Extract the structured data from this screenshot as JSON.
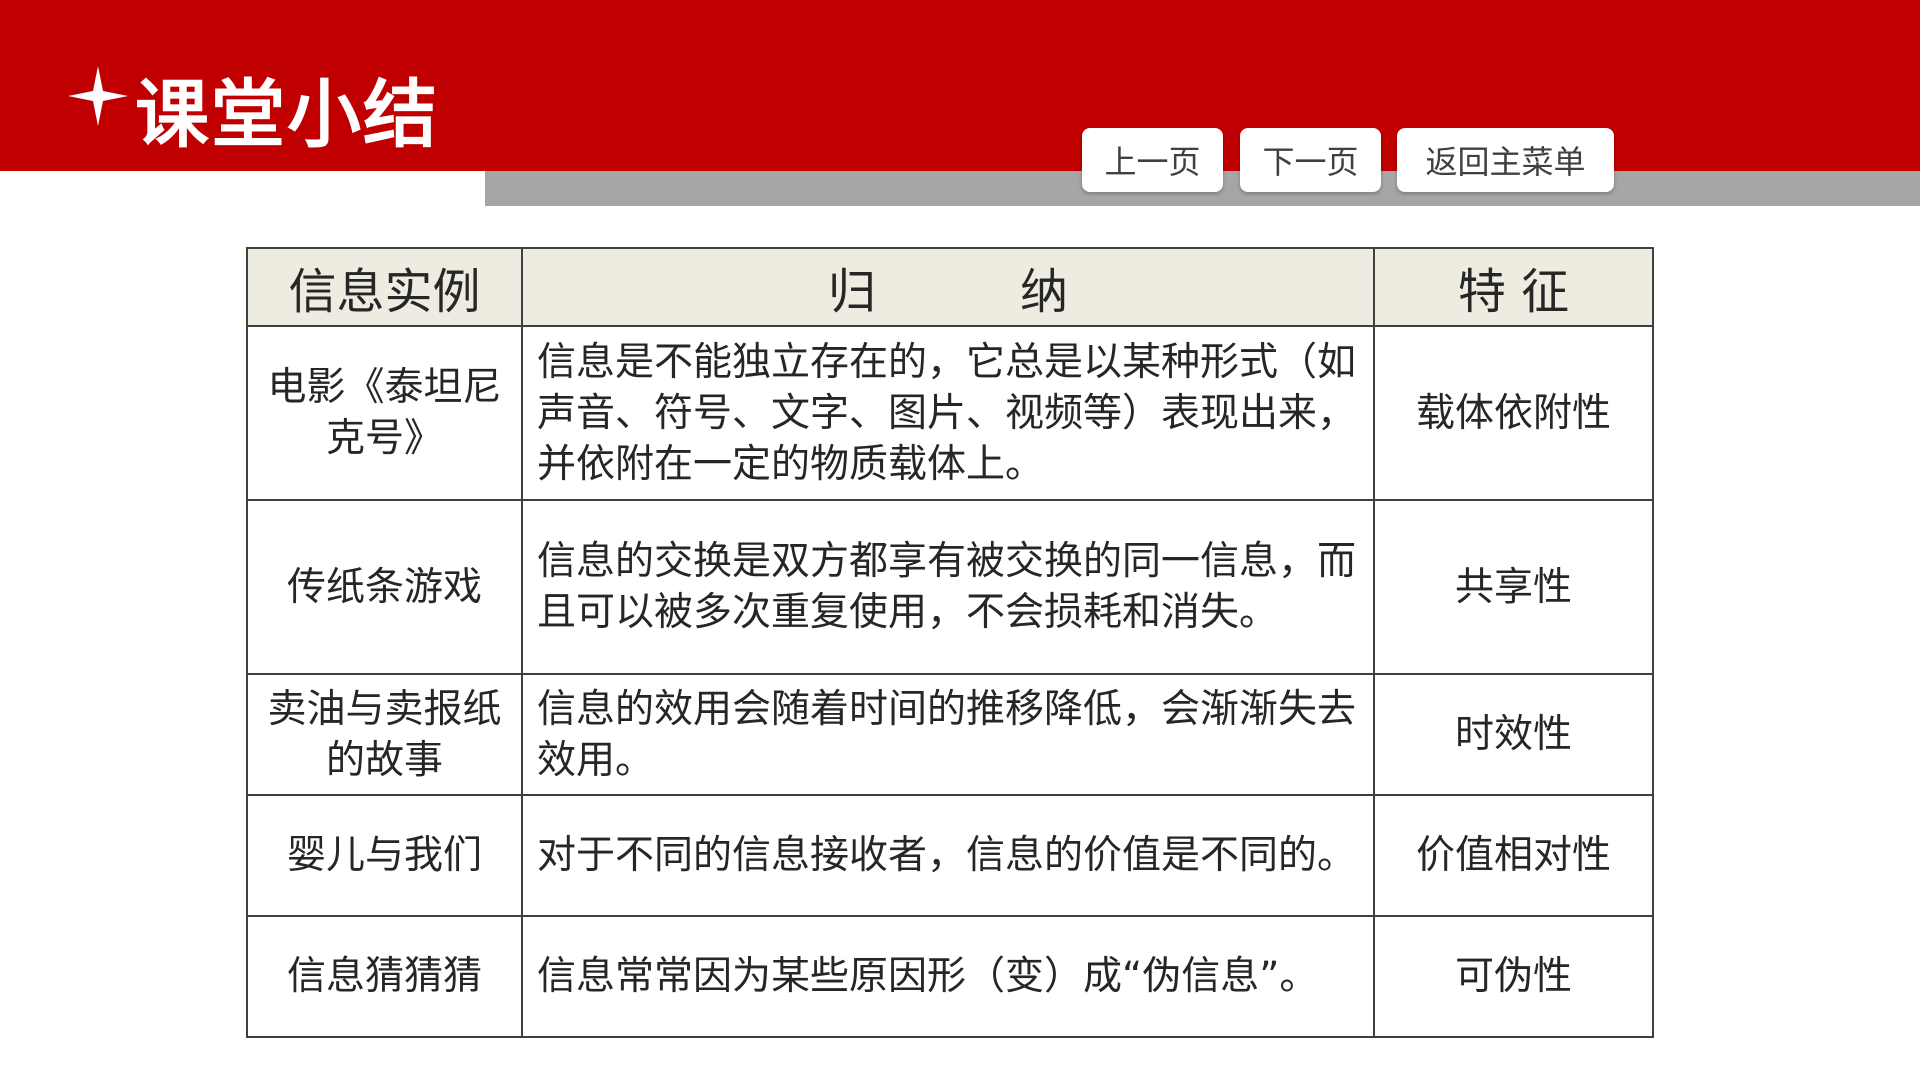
{
  "header": {
    "title": "课堂小结",
    "accent_color": "#c00000",
    "strip_color": "#a6a6a6",
    "icon": "star-icon"
  },
  "nav": {
    "prev_label": "上一页",
    "next_label": "下一页",
    "home_label": "返回主菜单"
  },
  "table": {
    "header_bg": "#eeece1",
    "columns": [
      "信息实例",
      "归　　　纳",
      "特 征"
    ],
    "rows": [
      {
        "example": "电影《泰坦尼克号》",
        "summary": "信息是不能独立存在的，它总是以某种形式（如声音、符号、文字、图片、视频等）表现出来，并依附在一定的物质载体上。",
        "feature": "载体依附性"
      },
      {
        "example": "传纸条游戏",
        "summary": "信息的交换是双方都享有被交换的同一信息，而且可以被多次重复使用，不会损耗和消失。",
        "feature": "共享性"
      },
      {
        "example": "卖油与卖报纸的故事",
        "summary": "信息的效用会随着时间的推移降低，会渐渐失去效用。",
        "feature": "时效性"
      },
      {
        "example": "婴儿与我们",
        "summary": "对于不同的信息接收者，信息的价值是不同的。",
        "feature": "价值相对性"
      },
      {
        "example": "信息猜猜猜",
        "summary": "信息常常因为某些原因形（变）成“伪信息”。",
        "feature": "可伪性"
      }
    ]
  }
}
